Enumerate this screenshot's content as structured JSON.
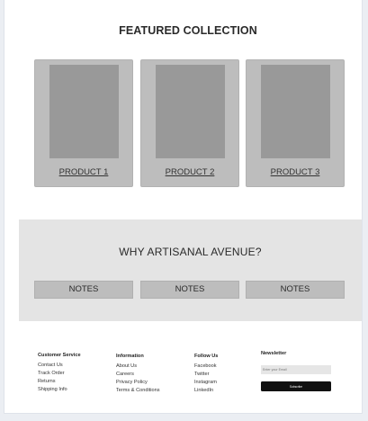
{
  "featured": {
    "title": "FEATURED COLLECTION",
    "products": [
      {
        "label": "PRODUCT 1"
      },
      {
        "label": "PRODUCT 2"
      },
      {
        "label": "PRODUCT 3"
      }
    ]
  },
  "why": {
    "title": "WHY ARTISANAL AVENUE?",
    "notes": [
      "NOTES",
      "NOTES",
      "NOTES"
    ]
  },
  "footer": {
    "customer_service": {
      "heading": "Customer Service",
      "links": [
        "Contact Us",
        "Track Order",
        "Returns",
        "Shipping Info"
      ]
    },
    "information": {
      "heading": "Information",
      "links": [
        "About Us",
        "Careers",
        "Privacy Policy",
        "Terms & Conditions"
      ]
    },
    "follow_us": {
      "heading": "Follow Us",
      "links": [
        "Facebook",
        "Twitter",
        "Instagram",
        "LinkedIn"
      ]
    },
    "newsletter": {
      "heading": "Newsletter",
      "email_placeholder": "Enter your Email",
      "subscribe_label": "Subscribe"
    }
  }
}
